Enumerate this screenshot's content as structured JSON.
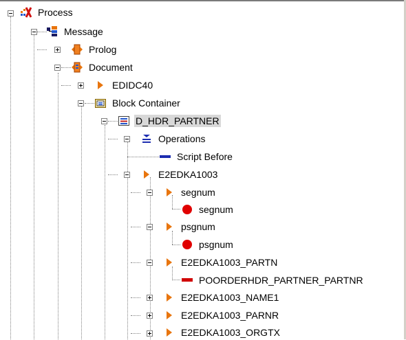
{
  "tree": {
    "process": {
      "label": "Process"
    },
    "message": {
      "label": "Message"
    },
    "prolog": {
      "label": "Prolog"
    },
    "document": {
      "label": "Document"
    },
    "edidc40": {
      "label": "EDIDC40"
    },
    "block_container": {
      "label": "Block Container"
    },
    "d_hdr_partner": {
      "label": "D_HDR_PARTNER",
      "selected": true
    },
    "operations": {
      "label": "Operations"
    },
    "script_before": {
      "label": "Script Before"
    },
    "e2edka1003": {
      "label": "E2EDKA1003"
    },
    "segnum_segment": {
      "label": "segnum"
    },
    "segnum_field": {
      "label": "segnum"
    },
    "psgnum_segment": {
      "label": "psgnum"
    },
    "psgnum_field": {
      "label": "psgnum"
    },
    "e2edka1003_partn": {
      "label": "E2EDKA1003_PARTN"
    },
    "poorderhdr_field": {
      "label": "POORDERHDR_PARTNER_PARTNR"
    },
    "e2edka1003_name1": {
      "label": "E2EDKA1003_NAME1"
    },
    "e2edka1003_parnr": {
      "label": "E2EDKA1003_PARNR"
    },
    "e2edka1003_orgtx": {
      "label": "E2EDKA1003_ORGTX"
    }
  },
  "colors": {
    "segment_icon": "#e8750e",
    "field_icon": "#e00000",
    "script_icon": "#1c2db0",
    "selection_bg": "#d8d8d8"
  }
}
